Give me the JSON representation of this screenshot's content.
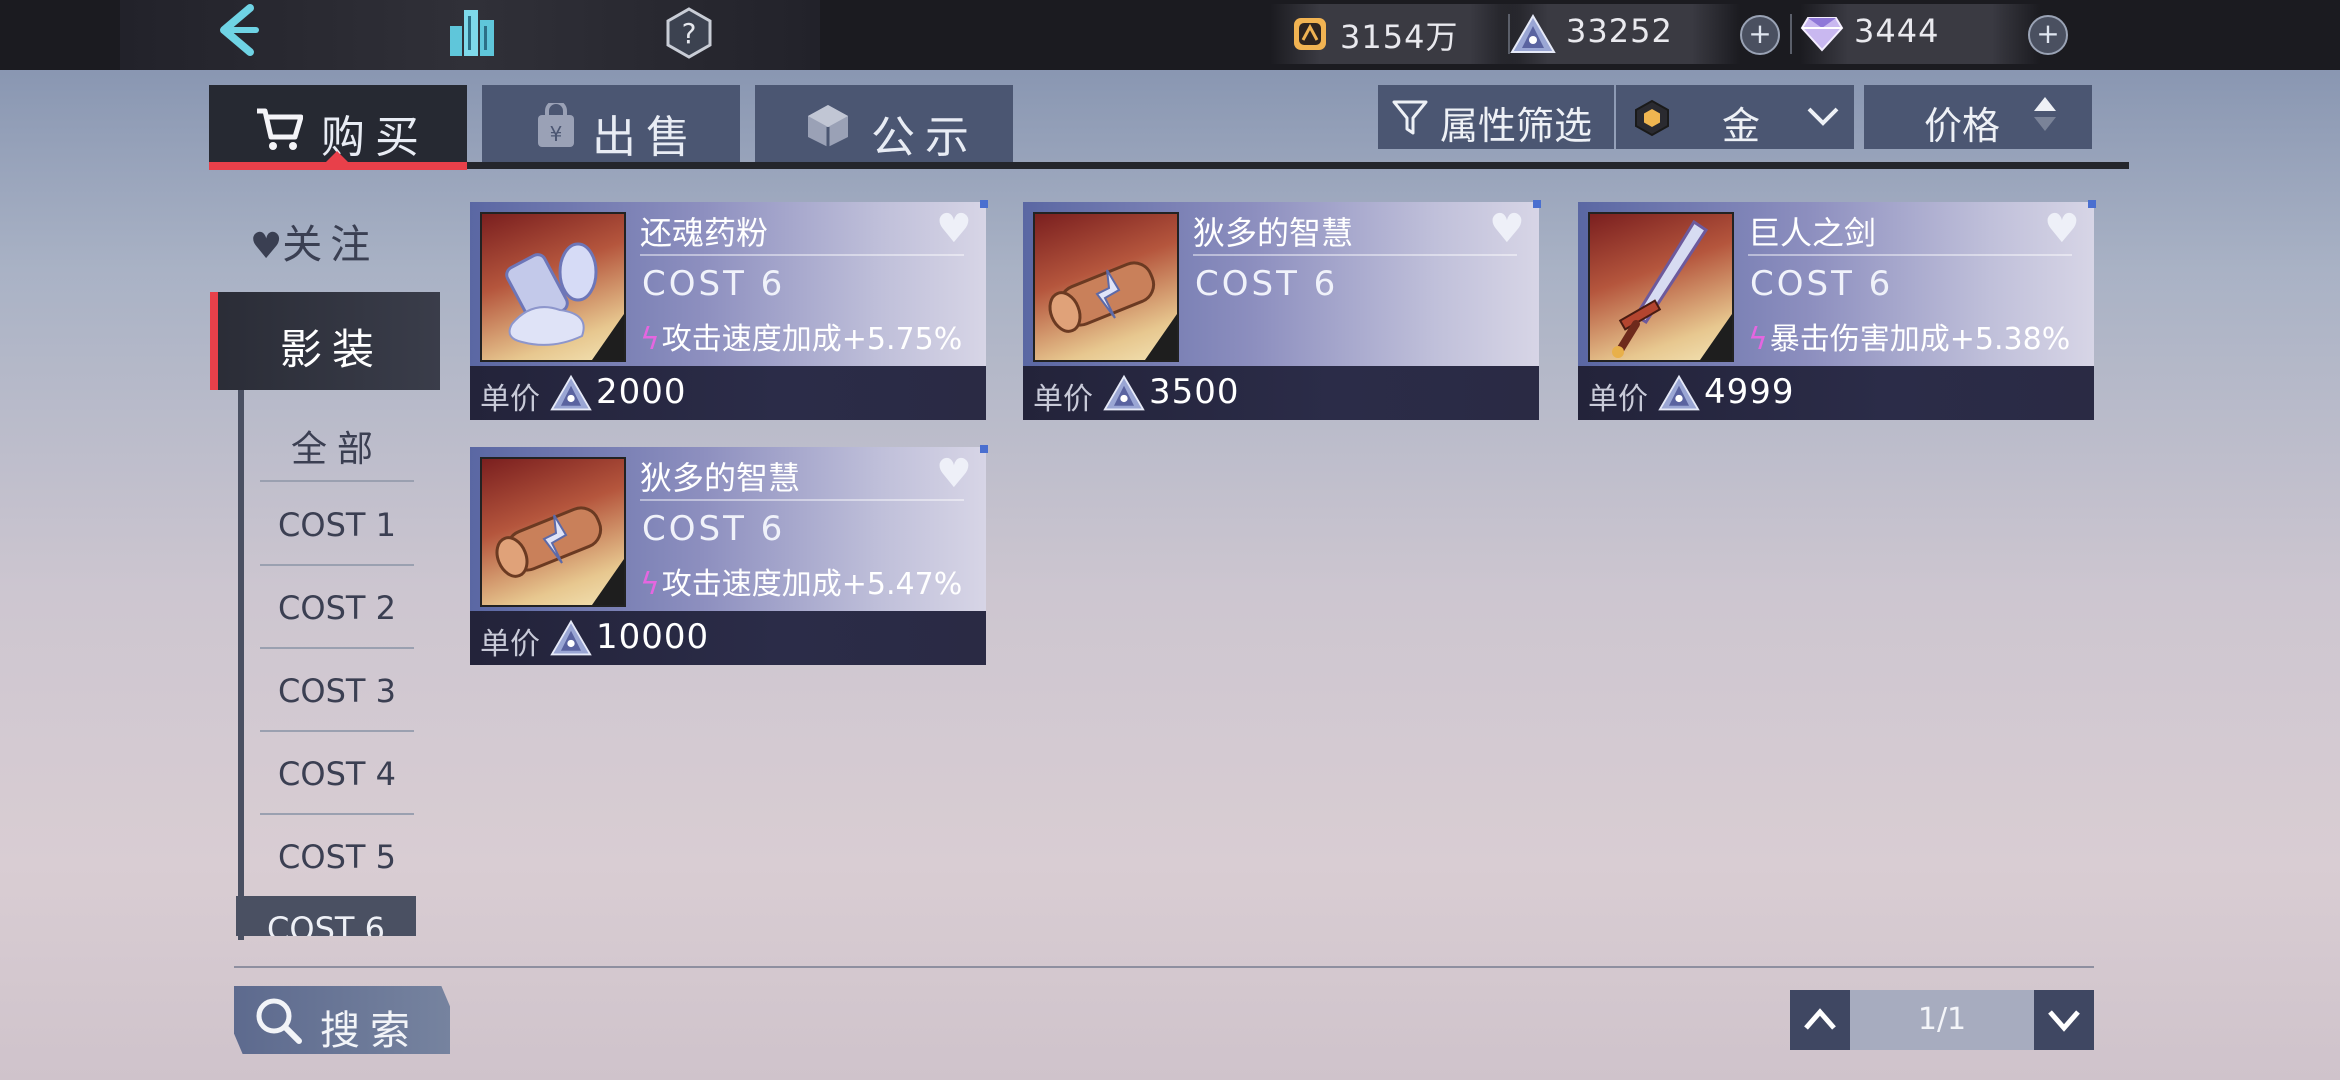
{
  "resources": {
    "gold": "3154万",
    "crystal": "33252",
    "diamond": "3444",
    "plus_symbol": "+"
  },
  "tabs": [
    {
      "label": "购买",
      "icon": "cart-icon"
    },
    {
      "label": "出售",
      "icon": "sell-bag-icon"
    },
    {
      "label": "公示",
      "icon": "cube-icon"
    }
  ],
  "filters": {
    "attribute_filter": "属性筛选",
    "rarity": "金",
    "price_sort": "价格"
  },
  "sidebar": {
    "follow": "关注",
    "category": "影装",
    "items": [
      "全部",
      "COST 1",
      "COST 2",
      "COST 3",
      "COST 4",
      "COST 5",
      "COST 6"
    ]
  },
  "cards": [
    {
      "name": "还魂药粉",
      "cost": "COST 6",
      "attr": "攻击速度加成+5.75%",
      "price_label": "单价",
      "price": "2000",
      "art": "powder"
    },
    {
      "name": "狄多的智慧",
      "cost": "COST 6",
      "attr": "",
      "price_label": "单价",
      "price": "3500",
      "art": "scroll"
    },
    {
      "name": "巨人之剑",
      "cost": "COST 6",
      "attr": "暴击伤害加成+5.38%",
      "price_label": "单价",
      "price": "4999",
      "art": "sword"
    },
    {
      "name": "狄多的智慧",
      "cost": "COST 6",
      "attr": "攻击速度加成+5.47%",
      "price_label": "单价",
      "price": "10000",
      "art": "scroll"
    }
  ],
  "search": {
    "label": "搜索"
  },
  "pagination": {
    "page": "1/1"
  },
  "colors": {
    "accent_red": "#e8404a",
    "tab_blue": "#4b5672",
    "bolt_pink": "#e566e0"
  }
}
